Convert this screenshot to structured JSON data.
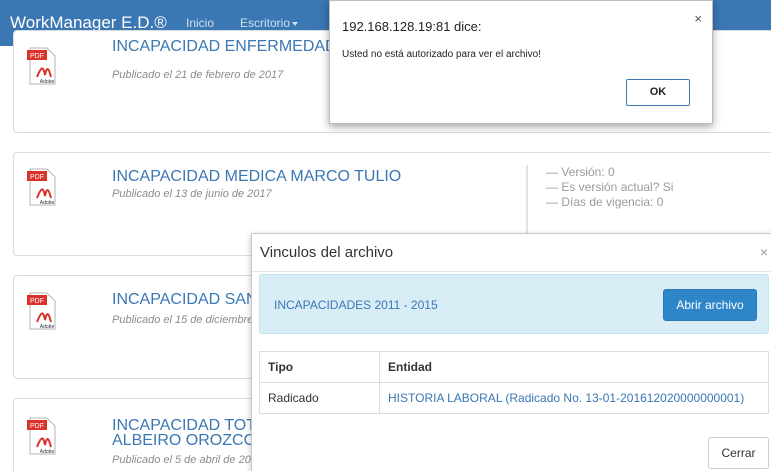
{
  "navbar": {
    "brand": "WorkManager E.D.®",
    "links": [
      "Inicio",
      "Escritorio"
    ]
  },
  "files": [
    {
      "title": "INCAPACIDAD ENFERMEDAD",
      "published": "Publicado el 21 de febrero de 2017"
    },
    {
      "title": "INCAPACIDAD MEDICA MARCO TULIO",
      "published": "Publicado el 13 de junio de 2017",
      "meta": [
        "— Versión: 0",
        "— Es versión actual? Si",
        "— Días de vigencia: 0"
      ]
    },
    {
      "title": "INCAPACIDAD SAN",
      "published": "Publicado el 15 de diciembre"
    },
    {
      "title": "INCAPACIDAD TOT",
      "title_line2": "ALBEIRO OROZCO",
      "published": "Publicado el 5 de abril de 20"
    }
  ],
  "pdf_icon": {
    "label": "PDF",
    "brand": "Adobe",
    "color": "#d9312b"
  },
  "vinculos_modal": {
    "title": "Vinculos del archivo",
    "close_glyph": "×",
    "alert_text": "INCAPACIDADES 2011 - 2015",
    "open_button": "Abrir archivo",
    "table": {
      "headers": [
        "Tipo",
        "Entidad"
      ],
      "rows": [
        [
          "Radicado",
          "HISTORIA LABORAL (Radicado No. 13-01-201612020000000001)"
        ]
      ]
    },
    "close_button": "Cerrar"
  },
  "browser_alert": {
    "title": "192.168.128.19:81 dice:",
    "message": "Usted no está autorizado para ver el archivo!",
    "ok_button": "OK",
    "close_glyph": "×"
  }
}
